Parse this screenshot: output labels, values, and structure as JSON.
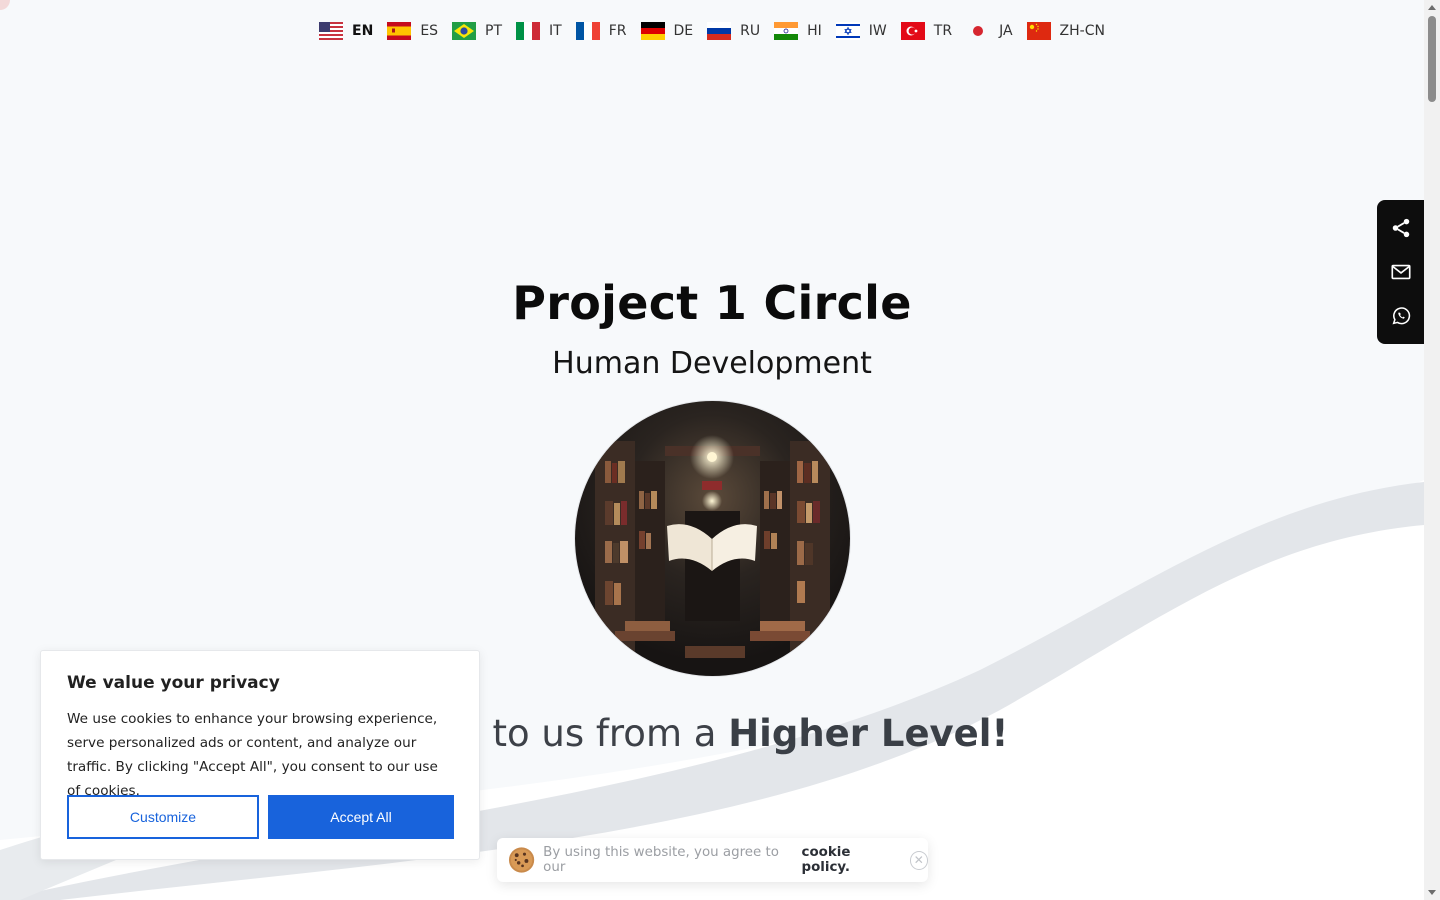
{
  "languages": [
    {
      "code": "EN",
      "icon": "flag-us-icon",
      "active": true
    },
    {
      "code": "ES",
      "icon": "flag-es-icon"
    },
    {
      "code": "PT",
      "icon": "flag-br-icon"
    },
    {
      "code": "IT",
      "icon": "flag-it-icon"
    },
    {
      "code": "FR",
      "icon": "flag-fr-icon"
    },
    {
      "code": "DE",
      "icon": "flag-de-icon"
    },
    {
      "code": "RU",
      "icon": "flag-ru-icon"
    },
    {
      "code": "HI",
      "icon": "flag-in-icon"
    },
    {
      "code": "IW",
      "icon": "flag-il-icon"
    },
    {
      "code": "TR",
      "icon": "flag-tr-icon"
    },
    {
      "code": "JA",
      "icon": "flag-jp-icon"
    },
    {
      "code": "ZH-CN",
      "icon": "flag-cn-icon"
    }
  ],
  "hero": {
    "title": "Project 1 Circle",
    "subtitle": "Human Development",
    "image_icon": "library-floating-book-image",
    "tagline_prefix": "omes to us from a ",
    "tagline_bold": "Higher Level!"
  },
  "share": {
    "items": [
      "share-icon",
      "email-icon",
      "whatsapp-icon"
    ]
  },
  "privacy": {
    "title": "We value your privacy",
    "body": "We use cookies to enhance your browsing experience, serve personalized ads or content, and analyze our traffic. By clicking \"Accept All\", you consent to our use of cookies.",
    "customize_label": "Customize",
    "accept_label": "Accept All"
  },
  "cookie_notice": {
    "text": "By using this website, you agree to our",
    "link": "cookie policy."
  },
  "colors": {
    "accent": "#1863dc",
    "background": "#f7f9fb",
    "share_bar": "#0d0d0d"
  }
}
